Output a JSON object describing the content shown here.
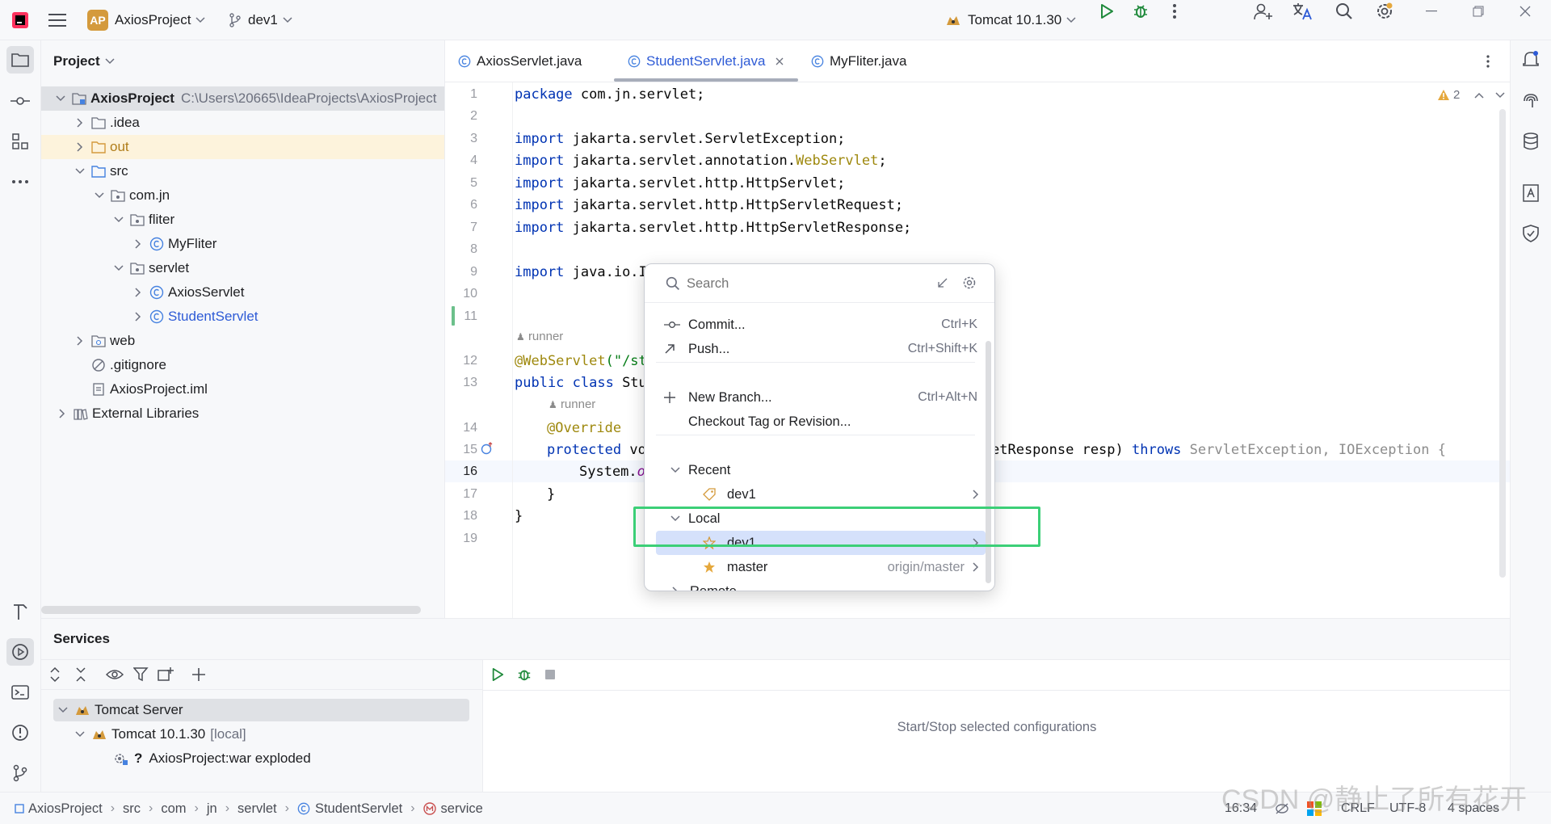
{
  "titlebar": {
    "project_badge": "AP",
    "project_name": "AxiosProject",
    "branch": "dev1",
    "run_config": "Tomcat 10.1.30"
  },
  "project_panel": {
    "title": "Project",
    "root_name": "AxiosProject",
    "root_path": "C:\\Users\\20665\\IdeaProjects\\AxiosProject",
    "items": [
      {
        "label": ".idea"
      },
      {
        "label": "out"
      },
      {
        "label": "src"
      },
      {
        "label": "com.jn"
      },
      {
        "label": "fliter"
      },
      {
        "label": "MyFliter"
      },
      {
        "label": "servlet"
      },
      {
        "label": "AxiosServlet"
      },
      {
        "label": "StudentServlet"
      },
      {
        "label": "web"
      },
      {
        "label": ".gitignore"
      },
      {
        "label": "AxiosProject.iml"
      },
      {
        "label": "External Libraries"
      }
    ]
  },
  "editor": {
    "tabs": [
      {
        "label": "AxiosServlet.java"
      },
      {
        "label": "StudentServlet.java"
      },
      {
        "label": "MyFliter.java"
      }
    ],
    "warnings": "2",
    "gutter": [
      "1",
      "2",
      "3",
      "4",
      "5",
      "6",
      "7",
      "8",
      "9",
      "10",
      "11",
      "12",
      "13",
      "14",
      "15",
      "16",
      "17",
      "18",
      "19"
    ],
    "code": {
      "l1_kw": "package",
      "l1_rest": " com.jn.servlet;",
      "l3_kw": "import",
      "l3_rest": " jakarta.servlet.ServletException;",
      "l4_kw": "import",
      "l4_rest": " jakarta.servlet.annotation.",
      "l4_ann": "WebServlet",
      "l4_end": ";",
      "l5_kw": "import",
      "l5_rest": " jakarta.servlet.http.HttpServlet;",
      "l6_kw": "import",
      "l6_rest": " jakarta.servlet.http.HttpServletRequest;",
      "l7_kw": "import",
      "l7_rest": " jakarta.servlet.http.HttpServletResponse;",
      "l9_kw": "import",
      "l9_rest": " java.io.I",
      "hint1": "runner",
      "l12_ann": "@WebServlet",
      "l12_rest": "(\"/st",
      "l13_kw": "public class",
      "l13_rest": " Stu",
      "hint2": "runner",
      "l14_ann": "@Override",
      "l15_kw": "protected",
      "l15_rest": " vo",
      "l15_tail_a": "etResponse resp) ",
      "l15_throws": "throws",
      "l15_tail_b": " ServletException, IOException {",
      "l16_rest": "System.",
      "l16_italic": "o",
      "l17": "}",
      "l18": "}"
    }
  },
  "popup": {
    "search_placeholder": "Search",
    "commit": "Commit...",
    "commit_key": "Ctrl+K",
    "push": "Push...",
    "push_key": "Ctrl+Shift+K",
    "new_branch": "New Branch...",
    "new_branch_key": "Ctrl+Alt+N",
    "checkout": "Checkout Tag or Revision...",
    "recent": "Recent",
    "recent_dev1": "dev1",
    "local": "Local",
    "local_dev1": "dev1",
    "local_master": "master",
    "local_master_tracking": "origin/master",
    "remote": "Remote"
  },
  "services": {
    "title": "Services",
    "tomcat_server": "Tomcat Server",
    "tomcat_version": "Tomcat 10.1.30",
    "tomcat_local": "[local]",
    "artifact": "AxiosProject:war exploded",
    "empty_text": "Start/Stop selected configurations"
  },
  "statusbar": {
    "crumbs": [
      "AxiosProject",
      "src",
      "com",
      "jn",
      "servlet",
      "StudentServlet",
      "service"
    ],
    "position": "16:34",
    "line_sep": "CRLF",
    "encoding": "UTF-8",
    "indent": "4 spaces"
  },
  "watermark": "CSDN @静止了所有花开"
}
